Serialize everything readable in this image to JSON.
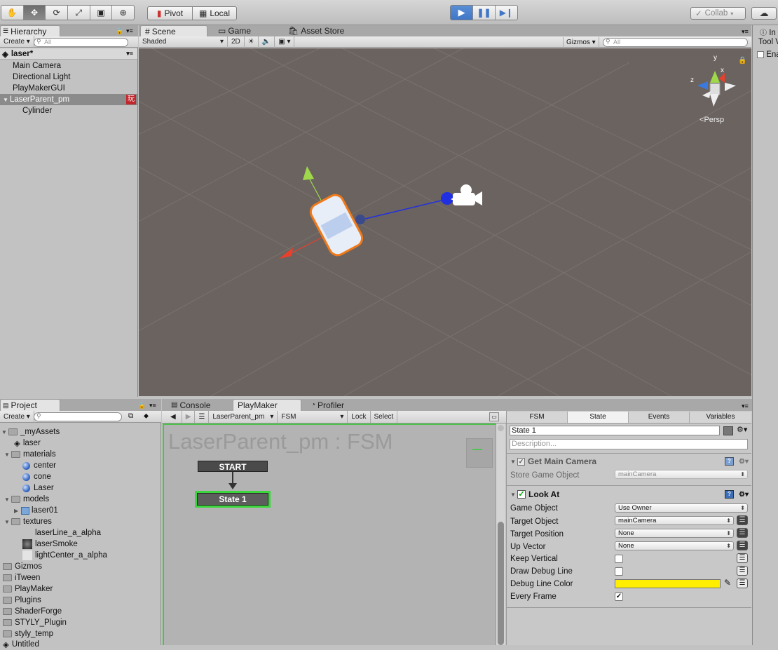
{
  "toolbar": {
    "tools": [
      "hand-icon",
      "move-icon",
      "rotate-icon",
      "scale-icon",
      "rect-icon",
      "transform-icon"
    ],
    "pivot_label": "Pivot",
    "local_label": "Local",
    "collab_label": "Collab"
  },
  "hierarchy": {
    "tab": "Hierarchy",
    "create": "Create",
    "search_placeholder": "All",
    "scene": "laser*",
    "items": [
      "Main Camera",
      "Directional Light",
      "PlayMakerGUI",
      "LaserParent_pm",
      "Cylinder"
    ],
    "badge": "玩"
  },
  "scene": {
    "tabs": [
      "Scene",
      "Game",
      "Asset Store"
    ],
    "shading": "Shaded",
    "mode_2d": "2D",
    "gizmos": "Gizmos",
    "search_placeholder": "All",
    "persp": "Persp",
    "axes": {
      "x": "x",
      "y": "y",
      "z": "z"
    },
    "colors": {
      "bg": "#6b6360",
      "selection": "#f07a1a",
      "x_axis": "#e8402a",
      "y_axis": "#9fd84a",
      "z_axis": "#2030e0"
    }
  },
  "inspector_stub": {
    "tab": "In",
    "line1": "Tool V",
    "line2": "Ena"
  },
  "project": {
    "tab": "Project",
    "create": "Create",
    "items": [
      {
        "label": "_myAssets",
        "type": "folder"
      },
      {
        "label": "laser",
        "type": "unity"
      },
      {
        "label": "materials",
        "type": "folder"
      },
      {
        "label": "center",
        "type": "sphere"
      },
      {
        "label": "cone",
        "type": "sphere"
      },
      {
        "label": "Laser",
        "type": "sphere"
      },
      {
        "label": "models",
        "type": "folder"
      },
      {
        "label": "laser01",
        "type": "mesh"
      },
      {
        "label": "textures",
        "type": "folder"
      },
      {
        "label": "laserLine_a_alpha",
        "type": "texture"
      },
      {
        "label": "laserSmoke",
        "type": "texture"
      },
      {
        "label": "lightCenter_a_alpha",
        "type": "texture"
      },
      {
        "label": "Gizmos",
        "type": "folder"
      },
      {
        "label": "iTween",
        "type": "folder"
      },
      {
        "label": "PlayMaker",
        "type": "folder"
      },
      {
        "label": "Plugins",
        "type": "folder"
      },
      {
        "label": "ShaderForge",
        "type": "folder"
      },
      {
        "label": "STYLY_Plugin",
        "type": "folder"
      },
      {
        "label": "styly_temp",
        "type": "folder"
      },
      {
        "label": "Untitled",
        "type": "unity"
      }
    ]
  },
  "bottom_tabs": [
    "Console",
    "PlayMaker",
    "Profiler"
  ],
  "playmaker": {
    "object_select": "LaserParent_pm",
    "fsm_select": "FSM",
    "lock": "Lock",
    "select": "Select",
    "graph_title": "LaserParent_pm : FSM",
    "start_label": "START",
    "state_label": "State 1",
    "minimap_dash": "—"
  },
  "fsm_inspector": {
    "tabs": [
      "FSM",
      "State",
      "Events",
      "Variables"
    ],
    "state_name": "State 1",
    "description_placeholder": "Description...",
    "action1": {
      "title": "Get Main Camera",
      "store_label": "Store Game Object",
      "store_value": "mainCamera"
    },
    "action2": {
      "title": "Look At",
      "rows": [
        {
          "label": "Game Object",
          "value": "Use Owner"
        },
        {
          "label": "Target Object",
          "value": "mainCamera"
        },
        {
          "label": "Target Position",
          "value": "None"
        },
        {
          "label": "Up Vector",
          "value": "None"
        }
      ],
      "keep_vertical": "Keep Vertical",
      "draw_debug_line": "Draw Debug Line",
      "debug_line_color": "Debug Line Color",
      "every_frame": "Every Frame",
      "debug_color": "#ffee00"
    }
  }
}
